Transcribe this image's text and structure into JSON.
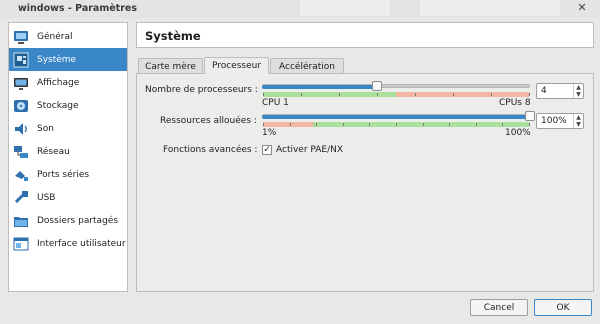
{
  "window": {
    "title": "windows - Paramètres",
    "close_glyph": "✕"
  },
  "sidebar": {
    "items": [
      {
        "label": "Général",
        "icon": "monitor-icon"
      },
      {
        "label": "Système",
        "icon": "motherboard-icon",
        "active": true
      },
      {
        "label": "Affichage",
        "icon": "display-icon"
      },
      {
        "label": "Stockage",
        "icon": "disk-icon"
      },
      {
        "label": "Son",
        "icon": "speaker-icon"
      },
      {
        "label": "Réseau",
        "icon": "network-icon"
      },
      {
        "label": "Ports séries",
        "icon": "serial-port-icon"
      },
      {
        "label": "USB",
        "icon": "usb-icon"
      },
      {
        "label": "Dossiers partagés",
        "icon": "folder-icon"
      },
      {
        "label": "Interface utilisateur",
        "icon": "ui-window-icon"
      }
    ]
  },
  "page": {
    "title": "Système"
  },
  "tabs": [
    {
      "label": "Carte mère",
      "active": false
    },
    {
      "label": "Processeur",
      "active": true
    },
    {
      "label": "Accélération",
      "active": false
    }
  ],
  "processor": {
    "cpu_label": "Nombre de processeurs :",
    "cpu_value": "4",
    "cpu_min_label": "CPU 1",
    "cpu_max_label": "CPUs 8",
    "cpu_level": 0.43,
    "cap_label": "Ressources allouées :",
    "cap_value": "100%",
    "cap_min_label": "1%",
    "cap_max_label": "100%",
    "cap_level": 1.0,
    "advanced_label": "Fonctions avancées :",
    "pae_label": "Activer PAE/NX",
    "pae_checked": "✓"
  },
  "buttons": {
    "cancel": "Cancel",
    "ok": "OK"
  },
  "colors": {
    "accent": "#3a87c8",
    "zone_green": "#a9e19c",
    "zone_red": "#f3b6a1"
  }
}
